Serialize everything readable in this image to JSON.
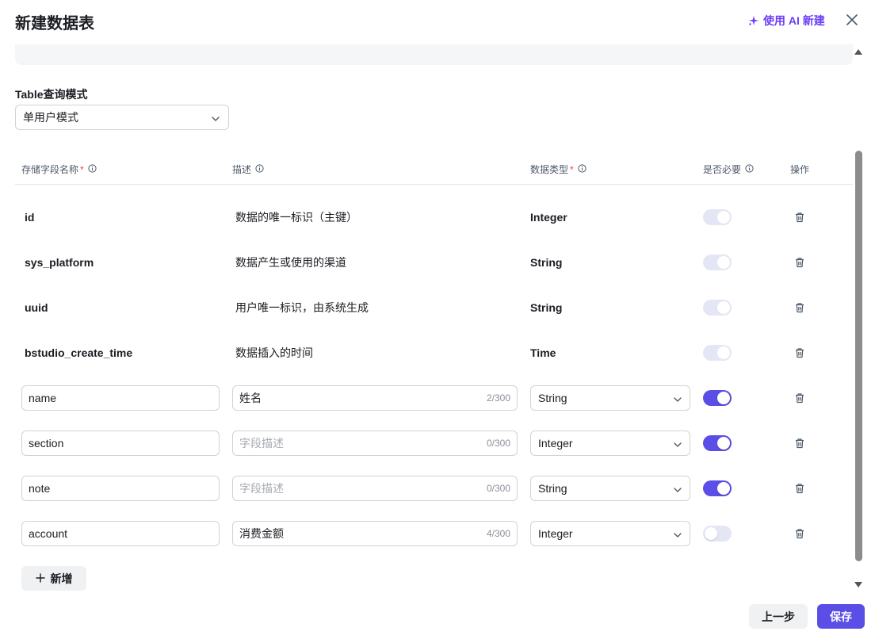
{
  "dialog": {
    "title": "新建数据表",
    "ai_button_label": "使用 AI 新建",
    "accent_color": "#5b4ee6"
  },
  "query_mode": {
    "label": "Table查询模式",
    "selected": "单用户模式"
  },
  "table": {
    "headers": {
      "name": "存储字段名称",
      "desc": "描述",
      "type": "数据类型",
      "required": "是否必要",
      "actions": "操作",
      "required_marker": "*"
    },
    "system_rows": [
      {
        "name": "id",
        "desc": "数据的唯一标识（主键）",
        "type": "Integer",
        "required": true
      },
      {
        "name": "sys_platform",
        "desc": "数据产生或使用的渠道",
        "type": "String",
        "required": true
      },
      {
        "name": "uuid",
        "desc": "用户唯一标识，由系统生成",
        "type": "String",
        "required": true
      },
      {
        "name": "bstudio_create_time",
        "desc": "数据插入的时间",
        "type": "Time",
        "required": true
      }
    ],
    "desc_placeholder": "字段描述",
    "custom_rows": [
      {
        "name": "name",
        "desc": "姓名",
        "count": "2/300",
        "type": "String",
        "required": true
      },
      {
        "name": "section",
        "desc": "",
        "count": "0/300",
        "type": "Integer",
        "required": true
      },
      {
        "name": "note",
        "desc": "",
        "count": "0/300",
        "type": "String",
        "required": true
      },
      {
        "name": "account",
        "desc": "消费金额",
        "count": "4/300",
        "type": "Integer",
        "required": false
      }
    ]
  },
  "footer": {
    "add_label": "新增",
    "prev_label": "上一步",
    "save_label": "保存"
  }
}
